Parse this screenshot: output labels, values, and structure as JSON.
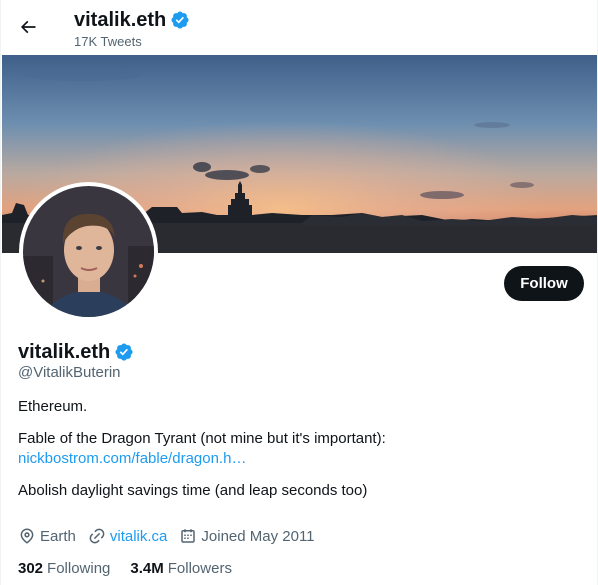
{
  "header": {
    "title": "vitalik.eth",
    "tweet_count": "17K Tweets"
  },
  "profile": {
    "display_name": "vitalik.eth",
    "handle": "@VitalikButerin",
    "follow_label": "Follow",
    "bio": {
      "line1": "Ethereum.",
      "line2": "Fable of the Dragon Tyrant (not mine but it's important):",
      "link": "nickbostrom.com/fable/dragon.h…",
      "line3": "Abolish daylight savings time (and leap seconds too)"
    },
    "meta": {
      "location": "Earth",
      "website": "vitalik.ca",
      "joined": "Joined May 2011"
    },
    "stats": {
      "following_count": "302",
      "following_label": "Following",
      "followers_count": "3.4M",
      "followers_label": "Followers"
    }
  },
  "colors": {
    "accent": "#1d9bf0",
    "text_primary": "#0f1419",
    "text_secondary": "#536471",
    "button_dark": "#0f1419"
  },
  "icons": [
    "back-arrow-icon",
    "verified-badge-icon",
    "location-icon",
    "link-icon",
    "calendar-icon"
  ]
}
